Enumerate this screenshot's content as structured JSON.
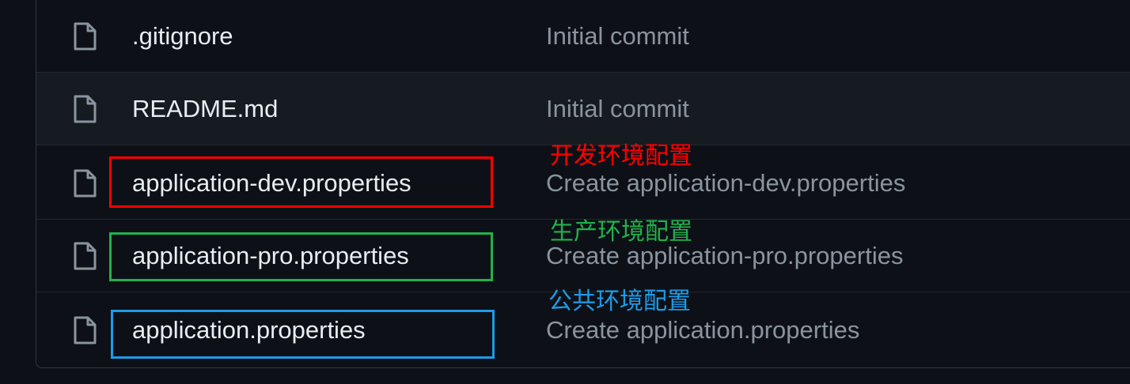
{
  "files": [
    {
      "name": ".gitignore",
      "commit": "Initial commit",
      "icon": "file-icon"
    },
    {
      "name": "README.md",
      "commit": "Initial commit",
      "icon": "file-icon"
    },
    {
      "name": "application-dev.properties",
      "commit": "Create application-dev.properties",
      "icon": "file-icon"
    },
    {
      "name": "application-pro.properties",
      "commit": "Create application-pro.properties",
      "icon": "file-icon"
    },
    {
      "name": "application.properties",
      "commit": "Create application.properties",
      "icon": "file-icon"
    }
  ],
  "annotations": [
    {
      "text": "开发环境配置",
      "color": "#ff0000"
    },
    {
      "text": "生产环境配置",
      "color": "#22b14c"
    },
    {
      "text": "公共环境配置",
      "color": "#1e9be8"
    }
  ],
  "colors": {
    "background": "#0d1117",
    "row_hover": "#161b22",
    "file_name": "#e6edf3",
    "commit_message": "#8b949e",
    "icon": "#8b949e",
    "dev_box": "#ff0000",
    "pro_box": "#22b14c",
    "common_box": "#1e9be8"
  }
}
